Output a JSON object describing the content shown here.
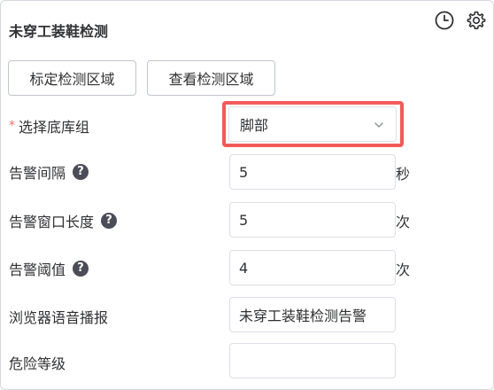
{
  "header": {
    "title": "未穿工装鞋检测",
    "icons": [
      "clock-icon",
      "gear-icon"
    ]
  },
  "buttons": {
    "mark_area": "标定检测区域",
    "view_area": "查看检测区域"
  },
  "form": {
    "base_group": {
      "required_mark": "*",
      "label": "选择底库组",
      "value": "脚部"
    },
    "alarm_interval": {
      "label": "告警间隔",
      "help": "?",
      "value": "5",
      "unit": "秒"
    },
    "alarm_window": {
      "label": "告警窗口长度",
      "help": "?",
      "value": "5",
      "unit": "次"
    },
    "alarm_threshold": {
      "label": "告警阈值",
      "help": "?",
      "value": "4",
      "unit": "次"
    },
    "browser_voice": {
      "label": "浏览器语音播报",
      "value": "未穿工装鞋检测告警"
    },
    "danger_level": {
      "label": "危险等级",
      "value": ""
    }
  },
  "colors": {
    "highlight": "#f25a5a",
    "required": "#f56c6c"
  }
}
